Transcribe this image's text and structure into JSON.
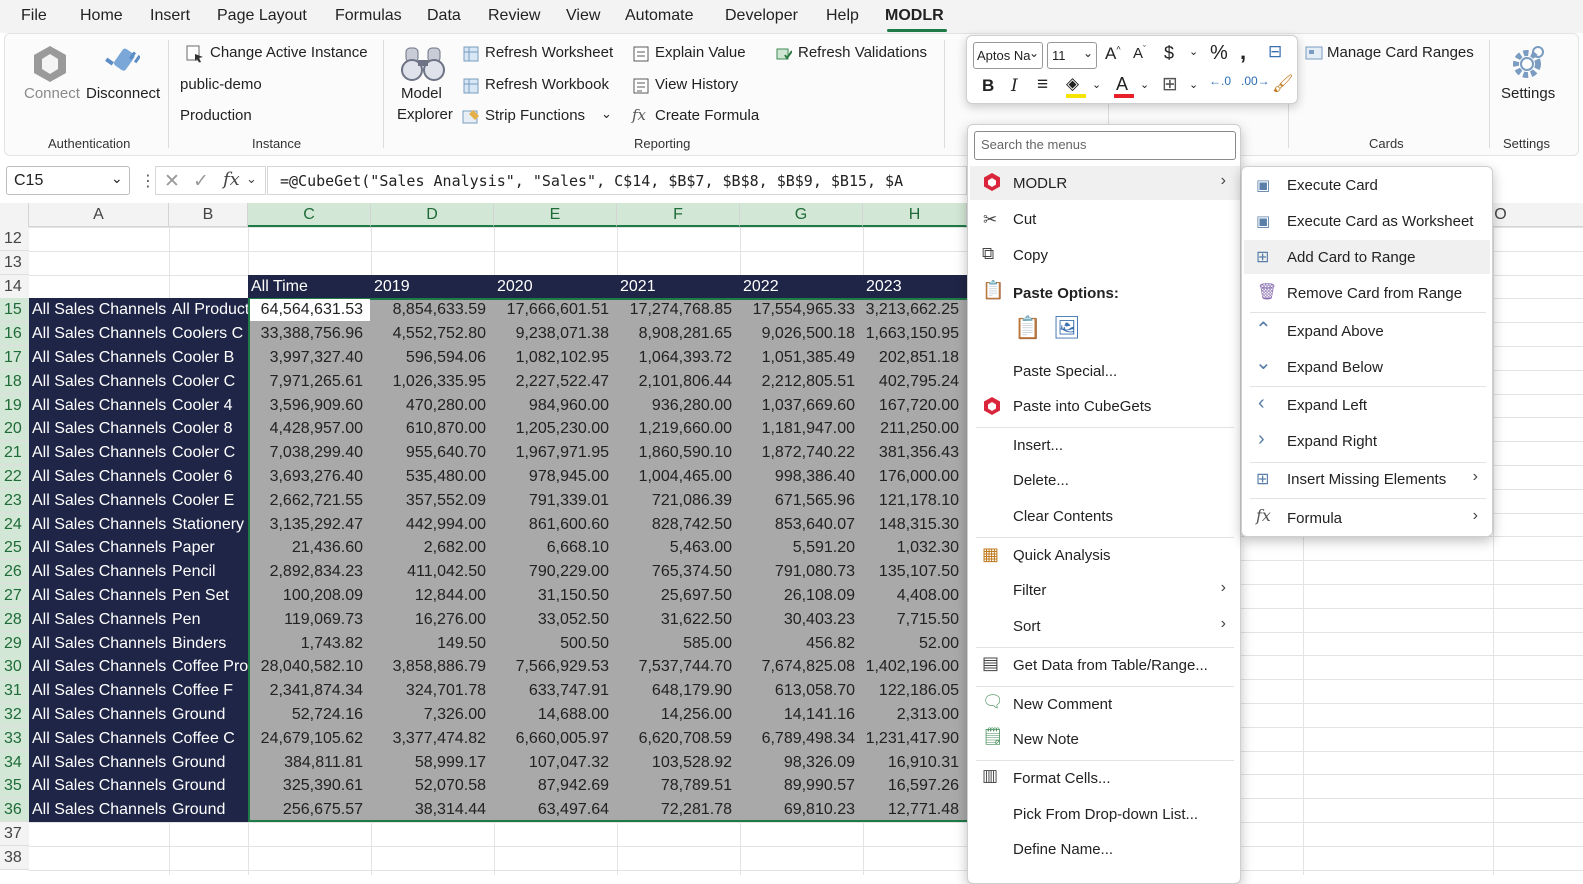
{
  "menu": {
    "items": [
      "File",
      "Home",
      "Insert",
      "Page Layout",
      "Formulas",
      "Data",
      "Review",
      "View",
      "Automate",
      "Developer",
      "Help",
      "MODLR"
    ],
    "active": "MODLR"
  },
  "ribbon": {
    "connect": "Connect",
    "disconnect": "Disconnect",
    "group_auth": "Authentication",
    "change_instance": "Change Active Instance",
    "instance_name": "public-demo",
    "instance_env": "Production",
    "group_instance": "Instance",
    "model_explorer": [
      "Model",
      "Explorer"
    ],
    "refresh_worksheet": "Refresh Worksheet",
    "refresh_workbook": "Refresh Workbook",
    "strip_functions": "Strip Functions",
    "explain_value": "Explain Value",
    "view_history": "View History",
    "create_formula": "Create Formula",
    "refresh_validations": "Refresh Validations",
    "group_reporting": "Reporting",
    "manage_card_ranges": "Manage Card Ranges",
    "group_cards": "Cards",
    "settings": "Settings",
    "group_settings": "Settings"
  },
  "mini_toolbar": {
    "font": "Aptos Na",
    "size": "11"
  },
  "formula_bar": {
    "name_box": "C15",
    "formula": "=@CubeGet(\"Sales Analysis\", \"Sales\", C$14, $B$7, $B$8, $B$9, $B15, $A"
  },
  "columns": [
    "A",
    "B",
    "C",
    "D",
    "E",
    "F",
    "G",
    "H",
    "O"
  ],
  "row_numbers": [
    "12",
    "13",
    "14",
    "15",
    "16",
    "17",
    "18",
    "19",
    "20",
    "21",
    "22",
    "23",
    "24",
    "25",
    "26",
    "27",
    "28",
    "29",
    "30",
    "31",
    "32",
    "33",
    "34",
    "35",
    "36",
    "37",
    "38"
  ],
  "header_row": [
    "All Time",
    "2019",
    "2020",
    "2021",
    "2022",
    "2023"
  ],
  "rows": [
    {
      "a": "All Sales Channels",
      "b": "All Products",
      "v": [
        "64,564,631.53",
        "8,854,633.59",
        "17,666,601.51",
        "17,274,768.85",
        "17,554,965.33",
        "3,213,662.25"
      ]
    },
    {
      "a": "All Sales Channels",
      "b": "Coolers C",
      "v": [
        "33,388,756.96",
        "4,552,752.80",
        "9,238,071.38",
        "8,908,281.65",
        "9,026,500.18",
        "1,663,150.95"
      ]
    },
    {
      "a": "All Sales Channels",
      "b": "Cooler B",
      "v": [
        "3,997,327.40",
        "596,594.06",
        "1,082,102.95",
        "1,064,393.72",
        "1,051,385.49",
        "202,851.18"
      ]
    },
    {
      "a": "All Sales Channels",
      "b": "Cooler C",
      "v": [
        "7,971,265.61",
        "1,026,335.95",
        "2,227,522.47",
        "2,101,806.44",
        "2,212,805.51",
        "402,795.24"
      ]
    },
    {
      "a": "All Sales Channels",
      "b": "Cooler 4",
      "v": [
        "3,596,909.60",
        "470,280.00",
        "984,960.00",
        "936,280.00",
        "1,037,669.60",
        "167,720.00"
      ]
    },
    {
      "a": "All Sales Channels",
      "b": "Cooler 8",
      "v": [
        "4,428,957.00",
        "610,870.00",
        "1,205,230.00",
        "1,219,660.00",
        "1,181,947.00",
        "211,250.00"
      ]
    },
    {
      "a": "All Sales Channels",
      "b": "Cooler C",
      "v": [
        "7,038,299.40",
        "955,640.70",
        "1,967,971.95",
        "1,860,590.10",
        "1,872,740.22",
        "381,356.43"
      ]
    },
    {
      "a": "All Sales Channels",
      "b": "Cooler 6",
      "v": [
        "3,693,276.40",
        "535,480.00",
        "978,945.00",
        "1,004,465.00",
        "998,386.40",
        "176,000.00"
      ]
    },
    {
      "a": "All Sales Channels",
      "b": "Cooler E",
      "v": [
        "2,662,721.55",
        "357,552.09",
        "791,339.01",
        "721,086.39",
        "671,565.96",
        "121,178.10"
      ]
    },
    {
      "a": "All Sales Channels",
      "b": "Stationery",
      "v": [
        "3,135,292.47",
        "442,994.00",
        "861,600.60",
        "828,742.50",
        "853,640.07",
        "148,315.30"
      ]
    },
    {
      "a": "All Sales Channels",
      "b": "Paper",
      "v": [
        "21,436.60",
        "2,682.00",
        "6,668.10",
        "5,463.00",
        "5,591.20",
        "1,032.30"
      ]
    },
    {
      "a": "All Sales Channels",
      "b": "Pencil",
      "v": [
        "2,892,834.23",
        "411,042.50",
        "790,229.00",
        "765,374.50",
        "791,080.73",
        "135,107.50"
      ]
    },
    {
      "a": "All Sales Channels",
      "b": "Pen Set",
      "v": [
        "100,208.09",
        "12,844.00",
        "31,150.50",
        "25,697.50",
        "26,108.09",
        "4,408.00"
      ]
    },
    {
      "a": "All Sales Channels",
      "b": "Pen",
      "v": [
        "119,069.73",
        "16,276.00",
        "33,052.50",
        "31,622.50",
        "30,403.23",
        "7,715.50"
      ]
    },
    {
      "a": "All Sales Channels",
      "b": "Binders",
      "v": [
        "1,743.82",
        "149.50",
        "500.50",
        "585.00",
        "456.82",
        "52.00"
      ]
    },
    {
      "a": "All Sales Channels",
      "b": "Coffee Products",
      "v": [
        "28,040,582.10",
        "3,858,886.79",
        "7,566,929.53",
        "7,537,744.70",
        "7,674,825.08",
        "1,402,196.00"
      ]
    },
    {
      "a": "All Sales Channels",
      "b": "Coffee F",
      "v": [
        "2,341,874.34",
        "324,701.78",
        "633,747.91",
        "648,179.90",
        "613,058.70",
        "122,186.05"
      ]
    },
    {
      "a": "All Sales Channels",
      "b": "Ground",
      "v": [
        "52,724.16",
        "7,326.00",
        "14,688.00",
        "14,256.00",
        "14,141.16",
        "2,313.00"
      ]
    },
    {
      "a": "All Sales Channels",
      "b": "Coffee C",
      "v": [
        "24,679,105.62",
        "3,377,474.82",
        "6,660,005.97",
        "6,620,708.59",
        "6,789,498.34",
        "1,231,417.90"
      ]
    },
    {
      "a": "All Sales Channels",
      "b": "Ground",
      "v": [
        "384,811.81",
        "58,999.17",
        "107,047.32",
        "103,528.92",
        "98,326.09",
        "16,910.31"
      ]
    },
    {
      "a": "All Sales Channels",
      "b": "Ground",
      "v": [
        "325,390.61",
        "52,070.58",
        "87,942.69",
        "78,789.51",
        "89,990.57",
        "16,597.26"
      ]
    },
    {
      "a": "All Sales Channels",
      "b": "Ground",
      "v": [
        "256,675.57",
        "38,314.44",
        "63,497.64",
        "72,281.78",
        "69,810.23",
        "12,771.48"
      ]
    }
  ],
  "context_menu": {
    "search_placeholder": "Search the menus",
    "modlr": "MODLR",
    "cut": "Cut",
    "copy": "Copy",
    "paste_options": "Paste Options:",
    "paste_special": "Paste Special...",
    "paste_cubegets": "Paste into CubeGets",
    "insert": "Insert...",
    "delete": "Delete...",
    "clear_contents": "Clear Contents",
    "quick_analysis": "Quick Analysis",
    "filter": "Filter",
    "sort": "Sort",
    "get_data": "Get Data from Table/Range...",
    "new_comment": "New Comment",
    "new_note": "New Note",
    "format_cells": "Format Cells...",
    "pick_dropdown": "Pick From Drop-down List...",
    "define_name": "Define Name..."
  },
  "submenu": {
    "execute_card": "Execute Card",
    "execute_card_ws": "Execute Card as Worksheet",
    "add_card": "Add Card to Range",
    "remove_card": "Remove Card from Range",
    "expand_above": "Expand Above",
    "expand_below": "Expand Below",
    "expand_left": "Expand Left",
    "expand_right": "Expand Right",
    "insert_missing": "Insert Missing Elements",
    "formula": "Formula"
  },
  "colors": {
    "accent": "#1e7a46",
    "header_fill": "#1f2546",
    "selection_fill": "#a9a9a9",
    "modlr_red": "#d9263c"
  }
}
